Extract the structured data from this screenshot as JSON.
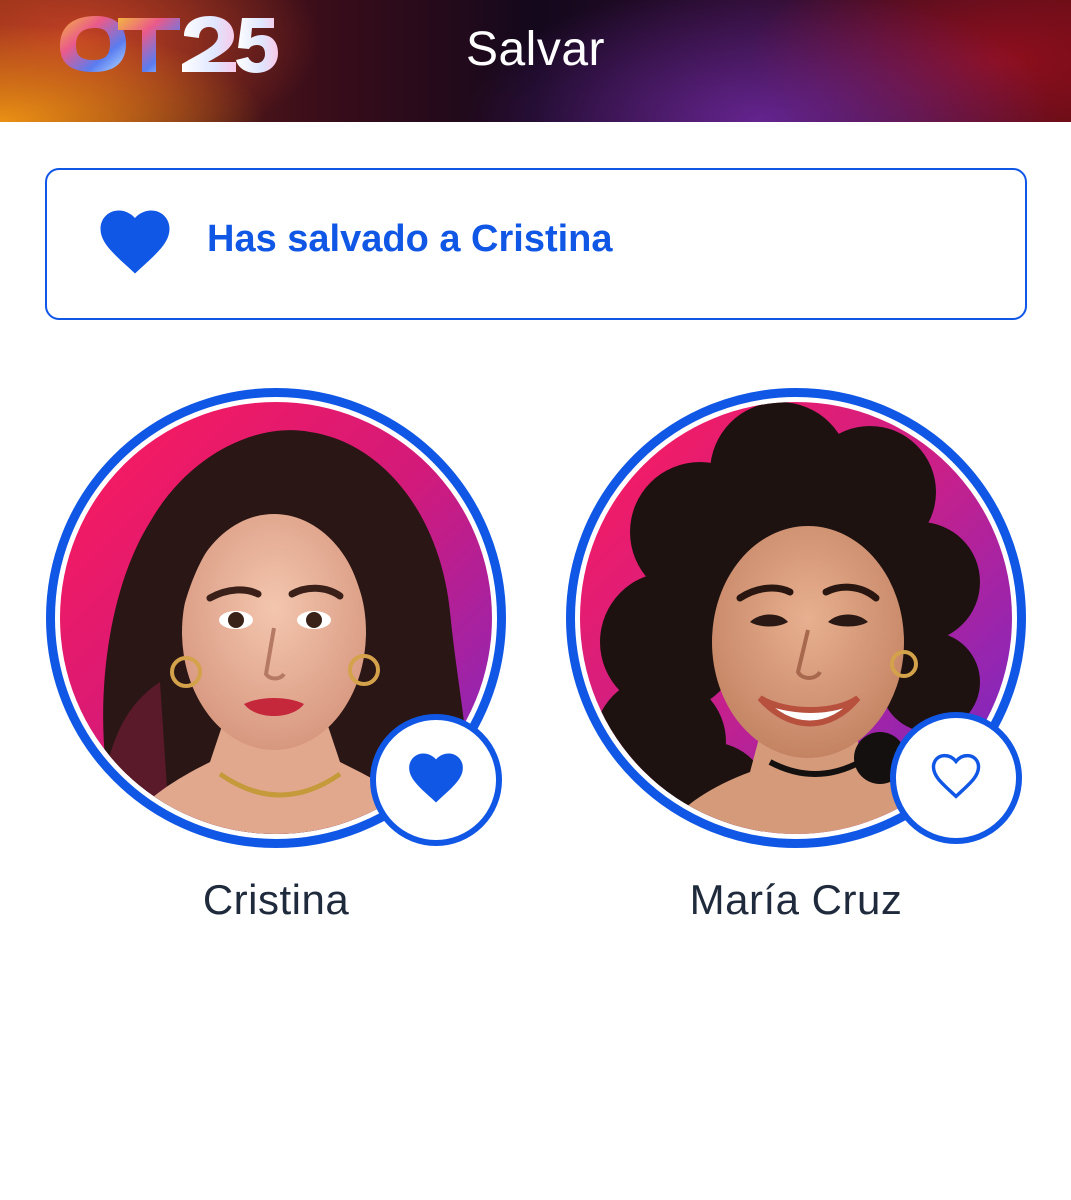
{
  "header": {
    "logo_text": "OT25",
    "title": "Salvar"
  },
  "banner": {
    "icon": "heart-filled-icon",
    "message": "Has salvado a Cristina"
  },
  "contestants": [
    {
      "name": "Cristina",
      "saved": true,
      "toggle_icon": "heart-filled-icon"
    },
    {
      "name": "María Cruz",
      "saved": false,
      "toggle_icon": "heart-outline-icon"
    }
  ],
  "colors": {
    "accent": "#1157e6",
    "name_text": "#1f2a3c",
    "background": "#ffffff"
  }
}
